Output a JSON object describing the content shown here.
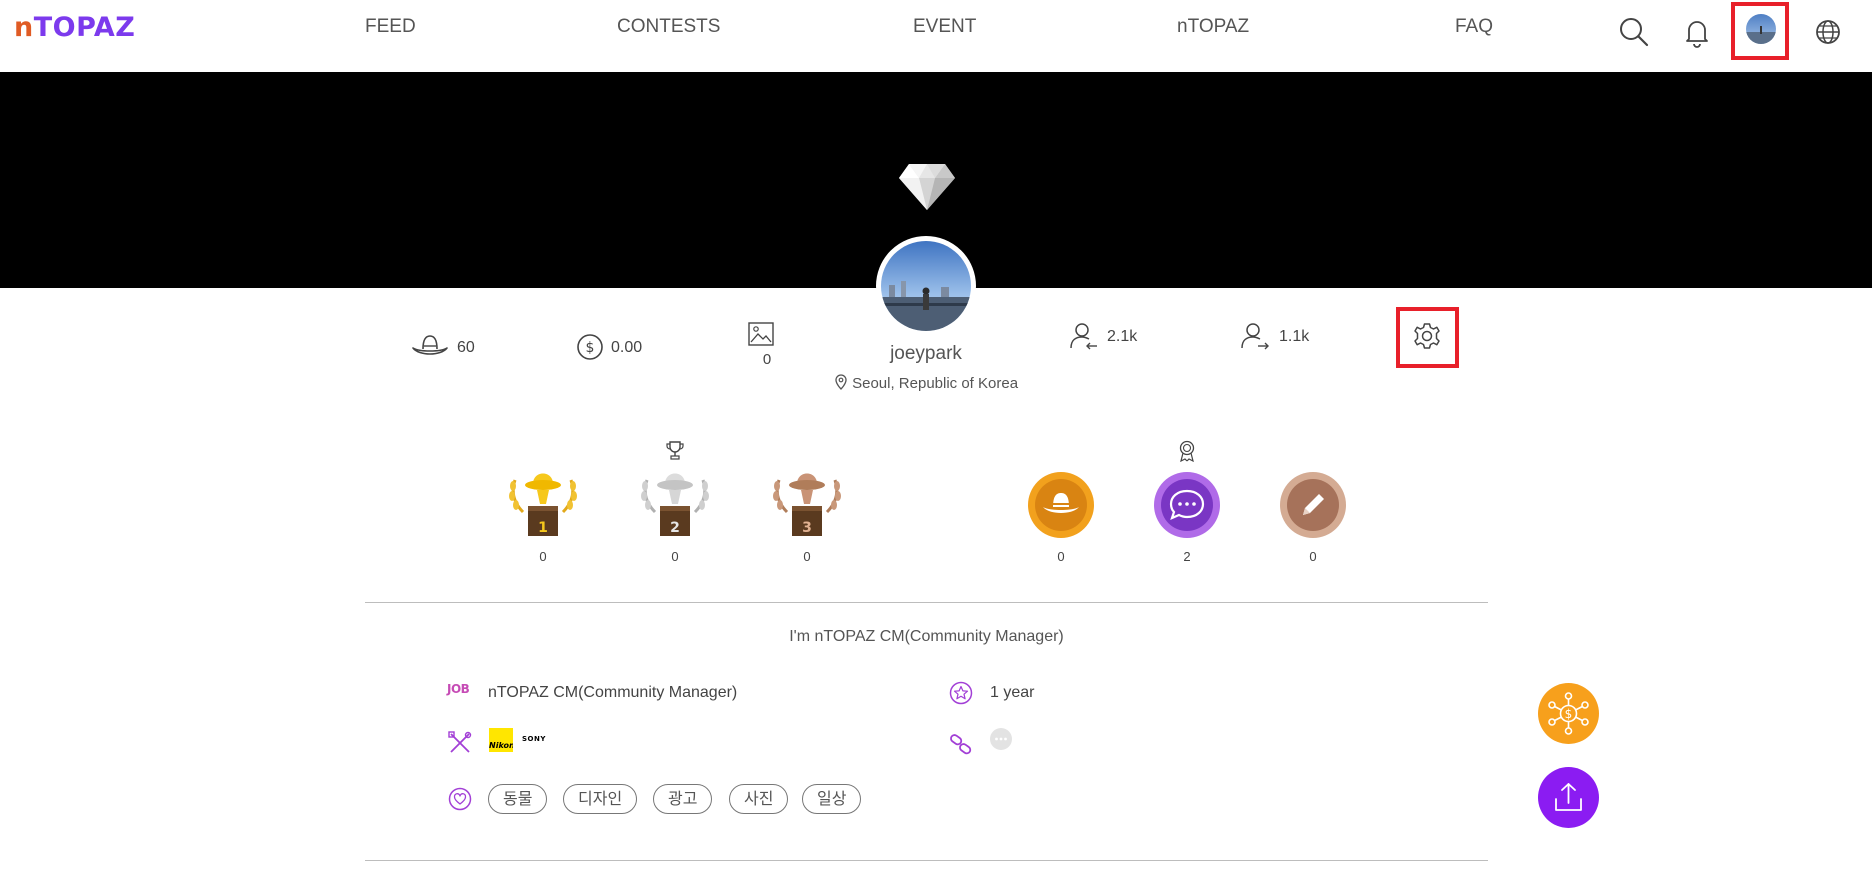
{
  "header": {
    "logo_prefix": "n",
    "logo_rest": "TOPAZ",
    "nav": [
      "FEED",
      "CONTESTS",
      "EVENT",
      "nTOPAZ",
      "FAQ"
    ],
    "icons": [
      "search-icon",
      "bell-icon",
      "avatar",
      "globe-icon"
    ]
  },
  "profile": {
    "username": "joeypark",
    "location": "Seoul, Republic of Korea",
    "hat_count": "60",
    "coin_balance": "0.00",
    "photo_count": "0",
    "followers": "2.1k",
    "following": "1.1k"
  },
  "trophies": [
    "0",
    "0",
    "0"
  ],
  "trophy_ranks": [
    "1",
    "2",
    "3"
  ],
  "badges": [
    "0",
    "2",
    "0"
  ],
  "bio": "I'm nTOPAZ CM(Community Manager)",
  "info": {
    "job_label": "JOB",
    "job": "nTOPAZ CM(Community Manager)",
    "tenure": "1 year",
    "gear_brands": [
      "Nikon",
      "SONY"
    ],
    "interests": [
      "동물",
      "디자인",
      "광고",
      "사진",
      "일상"
    ]
  },
  "colors": {
    "brand_purple": "#7c3aed",
    "brand_orange": "#e05b24",
    "fab_orange": "#f7a01c",
    "fab_purple": "#8b1cf2",
    "highlight_red": "#e8202a"
  }
}
